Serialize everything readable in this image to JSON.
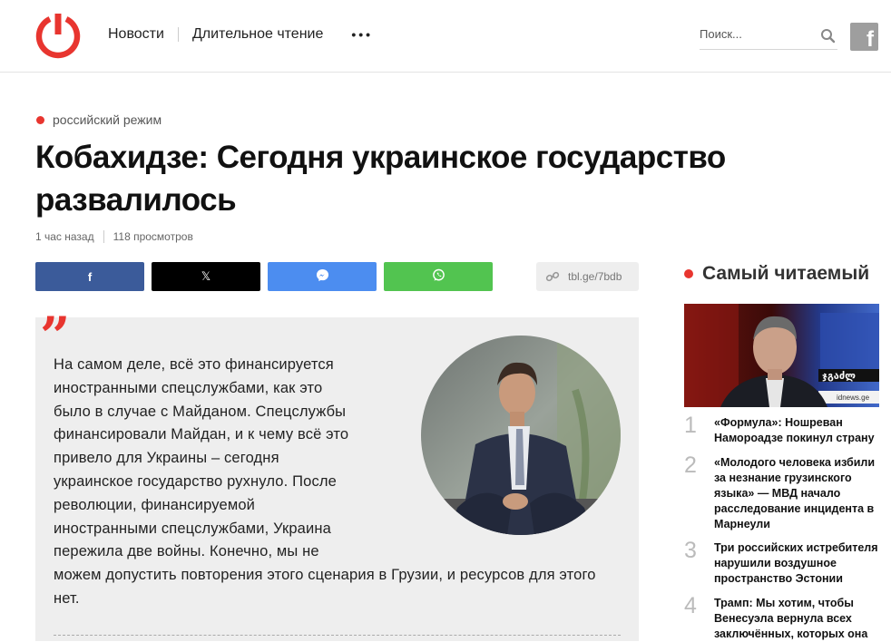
{
  "header": {
    "nav": [
      "Новости",
      "Длительное чтение"
    ],
    "more": "•••",
    "search_placeholder": "Поиск...",
    "fb_glyph": "f",
    "icons": {
      "logo": "power-logo-icon",
      "search": "magnifier-icon",
      "social": "facebook-icon"
    },
    "brand_color": "#e8352f"
  },
  "article": {
    "category": "российский режим",
    "title": "Кобахидзе: Сегодня украинское государство развалилось",
    "time": "1 час назад",
    "views": "118 просмотров",
    "share": {
      "facebook": "f",
      "x": "𝕏",
      "shortlink": "tbl.ge/7bdb"
    },
    "quote_mark": "❞",
    "quote_lines": [
      "На самом деле, всё это финансируется",
      "иностранными спецслужбами, как это",
      "было в случае с Майданом. Спецслужбы",
      "финансировали Майдан, и к чему всё это",
      "привело для Украины – сегодня",
      "украинское государство рухнуло. После",
      "революции, финансируемой",
      "иностранными спецслужбами, Украина",
      "пережила две войны. Конечно, мы не"
    ],
    "quote_tail": "можем допустить повторения этого сценария в Грузии, и ресурсов для этого нет."
  },
  "sidebar": {
    "title": "Самый читаемый",
    "image_caption": "idnews.ge",
    "items": [
      {
        "num": "1",
        "text": "«Формула»: Ношреван Намороадзе покинул страну"
      },
      {
        "num": "2",
        "text": "«Молодого человека избили за незнание грузинского языка» — МВД начало расследование инцидента в Марнеули"
      },
      {
        "num": "3",
        "text": "Три российских истребителя нарушили воздушное пространство Эстонии"
      },
      {
        "num": "4",
        "text": "Трамп: Мы хотим, чтобы Венесуэла вернула всех заключённых, которых она"
      }
    ]
  }
}
